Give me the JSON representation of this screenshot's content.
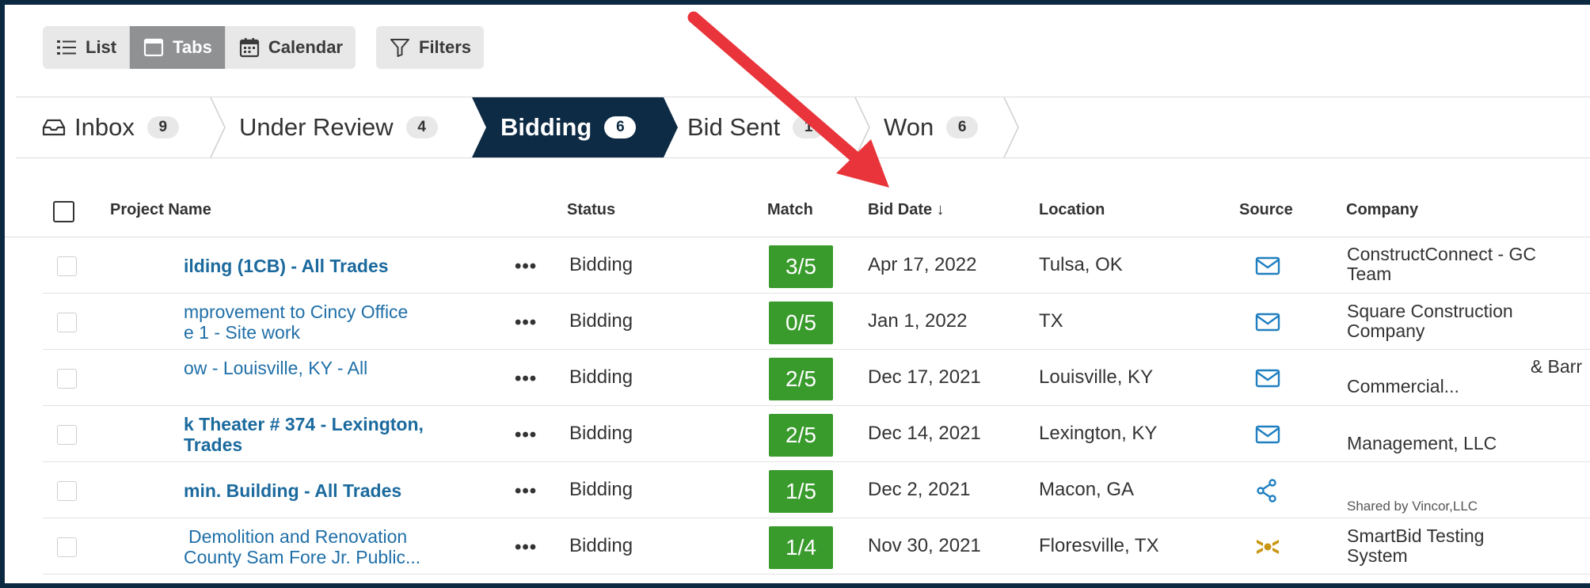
{
  "toolbar": {
    "list_label": "List",
    "tabs_label": "Tabs",
    "calendar_label": "Calendar",
    "filters_label": "Filters",
    "active_view": "Tabs"
  },
  "pipeline": {
    "stages": [
      {
        "label": "Inbox",
        "count": "9"
      },
      {
        "label": "Under Review",
        "count": "4"
      },
      {
        "label": "Bidding",
        "count": "6",
        "active": true
      },
      {
        "label": "Bid Sent",
        "count": "1"
      },
      {
        "label": "Won",
        "count": "6"
      }
    ]
  },
  "table": {
    "headers": {
      "project_name": "Project Name",
      "status": "Status",
      "match": "Match",
      "bid_date": "Bid Date ↓",
      "location": "Location",
      "source": "Source",
      "company": "Company"
    },
    "rows": [
      {
        "name1": "ilding (1CB) - All Trades",
        "name2": "",
        "status": "Bidding",
        "match": "3/5",
        "bid_date": "Apr 17, 2022",
        "location": "Tulsa, OK",
        "source_icon": "envelope-icon",
        "company1": "ConstructConnect - GC",
        "company2": "Team"
      },
      {
        "name1": "mprovement to Cincy Office",
        "name2": "e 1 - Site work",
        "status": "Bidding",
        "match": "0/5",
        "bid_date": "Jan 1, 2022",
        "location": "TX",
        "source_icon": "envelope-icon",
        "company1": "Square Construction",
        "company2": "Company"
      },
      {
        "name1": "ow - Louisville, KY - All",
        "name2": "",
        "status": "Bidding",
        "match": "2/5",
        "bid_date": "Dec 17, 2021",
        "location": "Louisville, KY",
        "source_icon": "envelope-icon",
        "company1": "& Barr",
        "company2": "Commercial..."
      },
      {
        "name1": "k Theater # 374 - Lexington,",
        "name2": "Trades",
        "status": "Bidding",
        "match": "2/5",
        "bid_date": "Dec 14, 2021",
        "location": "Lexington, KY",
        "source_icon": "envelope-icon",
        "company1": "",
        "company2": "Management, LLC"
      },
      {
        "name1": "min. Building - All Trades",
        "name2": "",
        "status": "Bidding",
        "match": "1/5",
        "bid_date": "Dec 2, 2021",
        "location": "Macon, GA",
        "source_icon": "share-icon",
        "company1": "",
        "company2": "Shared by Vincor,LLC"
      },
      {
        "name1": "Demolition and Renovation",
        "name2": "County Sam Fore Jr. Public...",
        "status": "Bidding",
        "match": "1/4",
        "bid_date": "Nov 30, 2021",
        "location": "Floresville, TX",
        "source_icon": "smartbid-icon",
        "company1": "SmartBid Testing",
        "company2": "System"
      }
    ]
  },
  "colors": {
    "active_tab": "#0d2b45",
    "match_green": "#3a9b2d",
    "link_blue": "#1f6fa8",
    "annotation_red": "#e8343a"
  }
}
